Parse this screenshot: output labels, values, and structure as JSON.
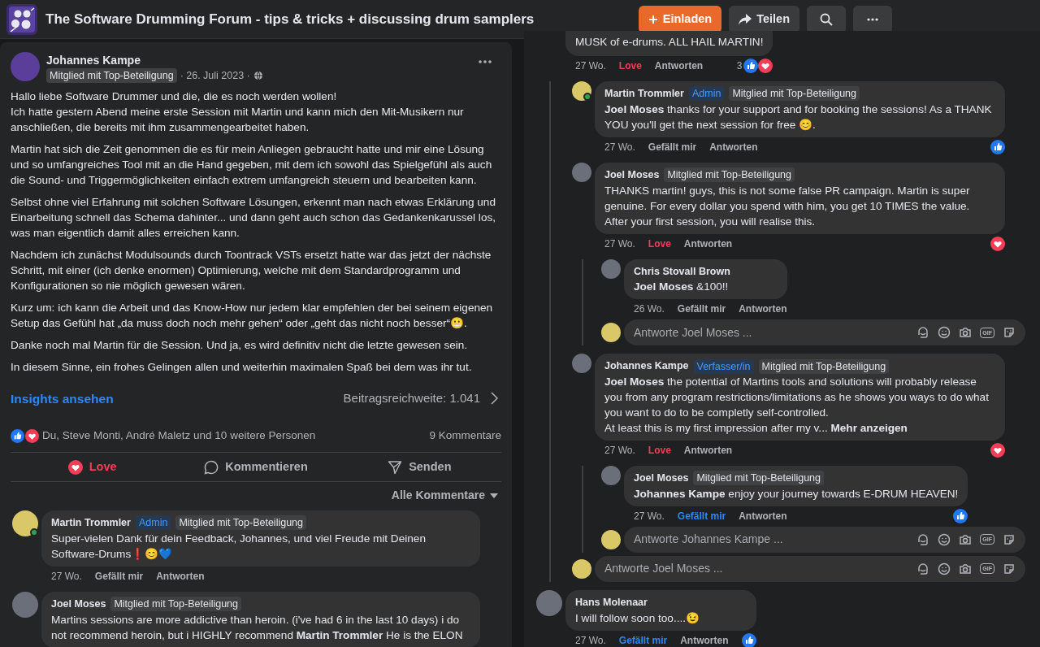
{
  "group": {
    "title": "The Software Drumming Forum - tips & tricks + discussing drum samplers"
  },
  "header_actions": [
    {
      "kind": "invite",
      "label": "Einladen"
    },
    {
      "kind": "share",
      "label": "Teilen"
    },
    {
      "kind": "search"
    },
    {
      "kind": "more"
    }
  ],
  "post": {
    "author": "Johannes Kampe",
    "badge": "Mitglied mit Top-Beteiligung",
    "date": "· 26. Juli 2023 ·",
    "paragraphs": [
      "Hallo liebe Software Drummer und die, die es noch werden wollen!\nIch hatte gestern Abend meine erste Session mit Martin und kann mich den Mit-Musikern nur anschließen, die bereits mit ihm zusammengearbeitet haben.",
      "Martin hat sich die Zeit genommen die es für mein Anliegen gebraucht hatte und mir eine Lösung und so umfangreiches Tool mit an die Hand gegeben, mit dem ich sowohl das Spielgefühl als auch die Sound- und Triggermöglichkeiten einfach extrem umfangreich steuern und bearbeiten kann.",
      "Selbst ohne viel Erfahrung mit solchen Software Lösungen, erkennt man nach etwas Erklärung und Einarbeitung schnell das Schema dahinter... und dann geht auch schon das Gedankenkarussel los, was man eigentlich damit alles erreichen kann.",
      "Nachdem ich zunächst Modulsounds durch Toontrack VSTs ersetzt hatte war das jetzt der nächste Schritt, mit einer (ich denke enormen) Optimierung, welche mit dem Standardprogramm und Konfigurationen so nie möglich gewesen wären.",
      "Kurz um: ich kann die Arbeit und das Know-How nur jedem klar empfehlen der bei seinem eigenen Setup das Gefühl hat „da muss doch noch mehr gehen“ oder „geht das nicht noch besser“😬.",
      "Danke noch mal Martin für die Session. Und ja, es wird definitiv nicht die letzte gewesen sein.",
      "In diesem Sinne, ein frohes Gelingen allen und weiterhin maximalen Spaß bei dem was ihr tut."
    ],
    "insights_link": "Insights ansehen",
    "reach": "Beitragsreichweite: 1.041",
    "reaction_types": [
      {
        "kind": "like"
      },
      {
        "kind": "love"
      }
    ],
    "reaction_summary": "Du, Steve Monti, André Maletz und 10 weitere Personen",
    "comment_count": "9 Kommentare",
    "actions": [
      {
        "kind": "love",
        "label": "Love",
        "active": true
      },
      {
        "kind": "comment",
        "label": "Kommentieren",
        "active": false
      },
      {
        "kind": "send",
        "label": "Senden",
        "active": false
      }
    ],
    "sort": "Alle Kommentare"
  },
  "left_comments": [
    {
      "author": "Martin Trommler",
      "online": true,
      "badges": [
        {
          "kind": "role",
          "label": "Admin"
        },
        {
          "kind": "member",
          "label": "Mitglied mit Top-Beteiligung"
        }
      ],
      "text": "Super-vielen Dank für dein Feedback, Johannes, und viel Freude mit Deinen Software-Drums❗😊💙",
      "time": "27 Wo.",
      "reacted": false,
      "react_label": "Gefällt mir",
      "reply_label": "Antworten"
    },
    {
      "author": "Joel Moses",
      "online": false,
      "badges": [
        {
          "kind": "member",
          "label": "Mitglied mit Top-Beteiligung"
        }
      ],
      "text": "Martins sessions are more addictive than heroin. (i've had 6 in the last 10 days) i do not recommend heroin, but i HIGHLY recommend **Martin Trommler** He is the ELON"
    }
  ],
  "right_comments": [
    {
      "kind": "continuation",
      "text": "MUSK of e-drums. ALL HAIL MARTIN!",
      "time": "27 Wo.",
      "reacted": true,
      "reaction": {
        "kind": "love"
      },
      "react_label": "Love",
      "reply_label": "Antworten",
      "reaction_count": "3",
      "reactions": [
        {
          "kind": "like"
        },
        {
          "kind": "love"
        }
      ],
      "children": [
        {
          "author": "Martin Trommler",
          "online": true,
          "badges": [
            {
              "kind": "role",
              "label": "Admin"
            },
            {
              "kind": "member",
              "label": "Mitglied mit Top-Beteiligung"
            }
          ],
          "text": "**Joel Moses** thanks for your support and for booking the sessions! As a THANK YOU you'll get the next session for free 😊.",
          "time": "27 Wo.",
          "reacted": false,
          "react_label": "Gefällt mir",
          "reply_label": "Antworten",
          "reactions": [
            {
              "kind": "like"
            }
          ]
        },
        {
          "author": "Joel Moses",
          "online": false,
          "badges": [
            {
              "kind": "member",
              "label": "Mitglied mit Top-Beteiligung"
            }
          ],
          "text": "THANKS martin! guys, this is not some false PR campaign. Martin is super genuine. For every dollar you spend with him, you get 10 TIMES the value. After your first session, you will realise this.",
          "time": "27 Wo.",
          "reacted": true,
          "reaction": {
            "kind": "love"
          },
          "react_label": "Love",
          "reply_label": "Antworten",
          "reactions": [
            {
              "kind": "love"
            }
          ],
          "children": [
            {
              "author": "Chris Stovall Brown",
              "online": false,
              "text": "**Joel Moses** &100!!",
              "time": "26 Wo.",
              "reacted": false,
              "react_label": "Gefällt mir",
              "reply_label": "Antworten"
            }
          ],
          "reply_box": {
            "placeholder": "Antworte Joel Moses ...",
            "gif": "GIF"
          }
        },
        {
          "author": "Johannes Kampe",
          "online": false,
          "badges": [
            {
              "kind": "role",
              "label": "Verfasser/in"
            },
            {
              "kind": "member",
              "label": "Mitglied mit Top-Beteiligung"
            }
          ],
          "text": "**Joel Moses** the potential of Martins tools and solutions will probably release you from any program restrictions/limitations as he shows you ways to do what you want to do to be completly self-controlled.\nAt least this is my first impression after my v...",
          "more_link": "Mehr anzeigen",
          "time": "27 Wo.",
          "reacted": true,
          "reaction": {
            "kind": "love"
          },
          "react_label": "Love",
          "reply_label": "Antworten",
          "reactions": [
            {
              "kind": "love"
            }
          ],
          "children": [
            {
              "author": "Joel Moses",
              "online": false,
              "badges": [
                {
                  "kind": "member",
                  "label": "Mitglied mit Top-Beteiligung"
                }
              ],
              "text": "**Johannes Kampe** enjoy your journey towards E-DRUM HEAVEN!",
              "time": "27 Wo.",
              "reacted": true,
              "reaction": {
                "kind": "like"
              },
              "react_label": "Gefällt mir",
              "reply_label": "Antworten",
              "reactions": [
                {
                  "kind": "like"
                }
              ]
            }
          ],
          "reply_box": {
            "placeholder": "Antworte Johannes Kampe ...",
            "gif": "GIF"
          }
        }
      ],
      "reply_box": {
        "placeholder": "Antworte Joel Moses ...",
        "gif": "GIF"
      }
    },
    {
      "author": "Hans Molenaar",
      "online": false,
      "text": "I will follow soon too....😉",
      "time": "27 Wo.",
      "reacted": true,
      "reaction": {
        "kind": "like"
      },
      "react_label": "Gefällt mir",
      "reply_label": "Antworten",
      "reactions": [
        {
          "kind": "like"
        }
      ]
    }
  ]
}
